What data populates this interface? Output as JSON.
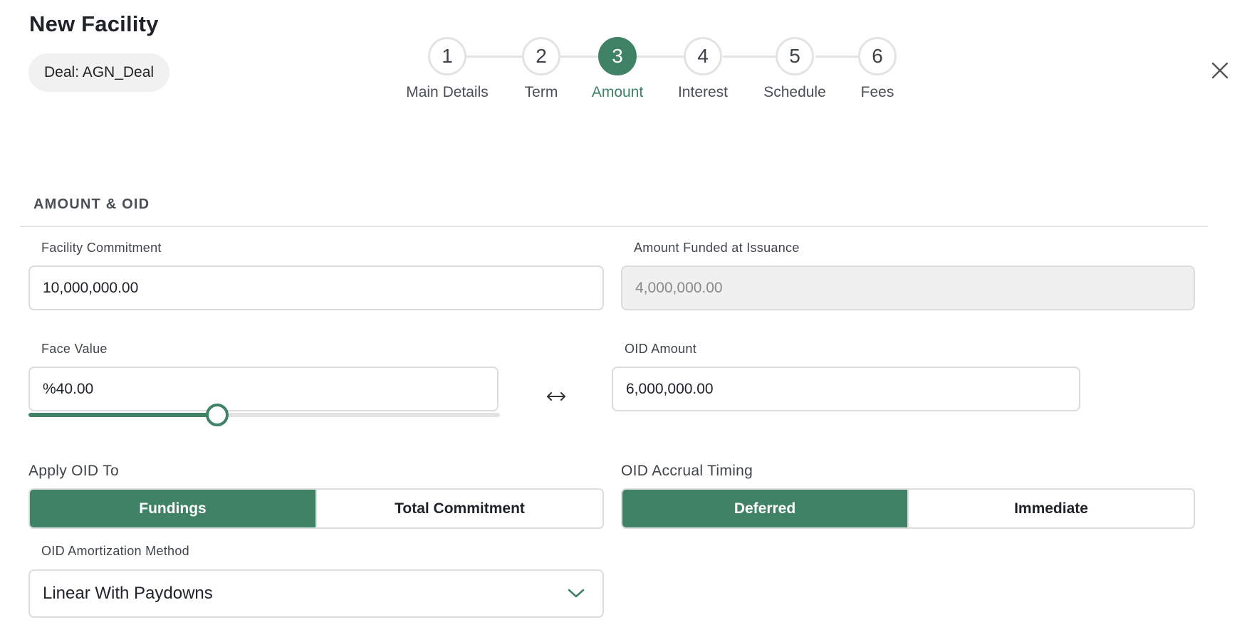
{
  "header": {
    "title": "New Facility",
    "deal_chip": "Deal: AGN_Deal"
  },
  "stepper": {
    "active_index": 2,
    "steps": [
      {
        "number": "1",
        "label": "Main Details"
      },
      {
        "number": "2",
        "label": "Term"
      },
      {
        "number": "3",
        "label": "Amount"
      },
      {
        "number": "4",
        "label": "Interest"
      },
      {
        "number": "5",
        "label": "Schedule"
      },
      {
        "number": "6",
        "label": "Fees"
      }
    ]
  },
  "section": {
    "title": "AMOUNT & OID"
  },
  "fields": {
    "facility_commitment": {
      "label": "Facility Commitment",
      "value": "10,000,000.00"
    },
    "amount_funded": {
      "label": "Amount Funded at Issuance",
      "value": "4,000,000.00"
    },
    "face_value": {
      "label": "Face Value",
      "value": "%40.00",
      "slider_percent": 40
    },
    "oid_amount": {
      "label": "OID Amount",
      "value": "6,000,000.00"
    }
  },
  "apply_oid_to": {
    "label": "Apply OID To",
    "options": [
      "Fundings",
      "Total Commitment"
    ],
    "selected": "Fundings"
  },
  "oid_accrual_timing": {
    "label": "OID Accrual Timing",
    "options": [
      "Deferred",
      "Immediate"
    ],
    "selected": "Deferred"
  },
  "oid_amortization": {
    "label": "OID Amortization Method",
    "value": "Linear With Paydowns"
  },
  "icons": {
    "close": "close-icon",
    "swap": "swap-horizontal-icon",
    "dropdown": "chevron-down-icon"
  },
  "colors": {
    "accent": "#3f8265",
    "border": "#dcdcdc",
    "disabled_bg": "#f0f0f0"
  }
}
